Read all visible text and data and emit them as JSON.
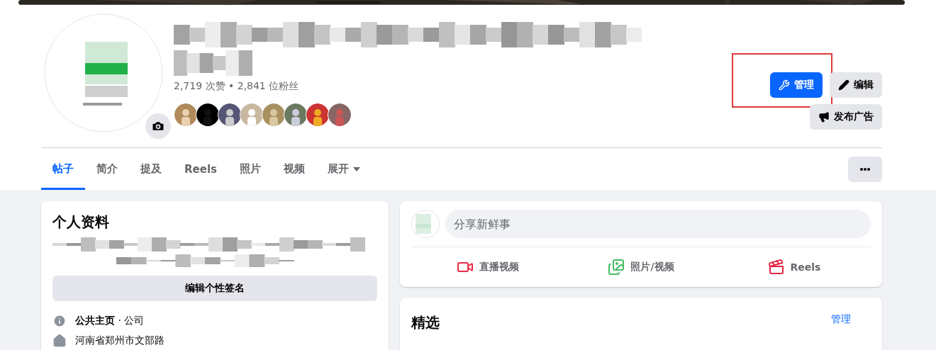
{
  "profile": {
    "name": {
      "kind": "blurred"
    },
    "stats": "2,719 次赞 • 2,841 位粉丝"
  },
  "actions": [
    {
      "kind": "manage",
      "label": "管理",
      "primary": true,
      "highlighted": true
    },
    {
      "kind": "edit",
      "label": "编辑",
      "primary": false,
      "highlighted": false
    },
    {
      "kind": "advertise",
      "label": "发布广告",
      "primary": false,
      "highlighted": false
    }
  ],
  "tabs": [
    {
      "label": "帖子",
      "selected": true,
      "kind": "tab"
    },
    {
      "label": "简介",
      "selected": false,
      "kind": "tab"
    },
    {
      "label": "提及",
      "selected": false,
      "kind": "tab"
    },
    {
      "label": "Reels",
      "selected": false,
      "kind": "tab"
    },
    {
      "label": "照片",
      "selected": false,
      "kind": "tab"
    },
    {
      "label": "视频",
      "selected": false,
      "kind": "tab"
    },
    {
      "label": "展开",
      "selected": false,
      "kind": "dropdown"
    }
  ],
  "intro": {
    "title": "个人资料",
    "bio": {
      "kind": "blurred"
    },
    "button": "编辑个性签名",
    "details": [
      {
        "kind": "info",
        "text": "**公共主页** · 公司"
      },
      {
        "kind": "place",
        "text": "河南省郑州市文部路"
      }
    ]
  },
  "composer": {
    "placeholder": "分享新鲜事",
    "actions": [
      {
        "kind": "live",
        "label": "直播视频"
      },
      {
        "label": "照片/视频"
      },
      {
        "kind": "reels",
        "label": "Reels"
      }
    ]
  },
  "featured": {
    "title": "精选",
    "link": "管理"
  }
}
